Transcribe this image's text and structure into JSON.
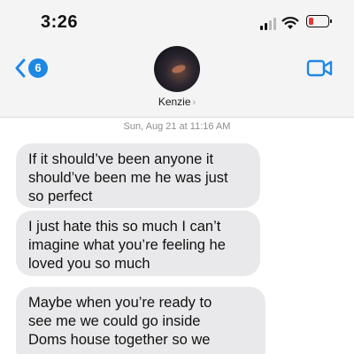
{
  "status_bar": {
    "time": "3:26",
    "battery_color": "#e53935"
  },
  "nav": {
    "back_badge_count": "6",
    "back_icon": "chevron-left-icon",
    "video_icon": "video-camera-icon",
    "accent_color": "#1e88e5"
  },
  "contact": {
    "name": "Kenzie",
    "chevron": "›"
  },
  "thread": {
    "timestamp_label": "Sun, Aug 21 at 11:16 AM",
    "messages": [
      {
        "text": "If it should’ve been anyone it\nshould’ve been me he was just\nso perfect",
        "direction": "incoming"
      },
      {
        "text": "I just hate this so much I can’t\nimagine what you’re feeling he\nloved you so much",
        "direction": "incoming"
      },
      {
        "text": "Maybe when you’re ready to\nsee me we could go inside\nDoms house together so we",
        "direction": "incoming"
      }
    ]
  }
}
